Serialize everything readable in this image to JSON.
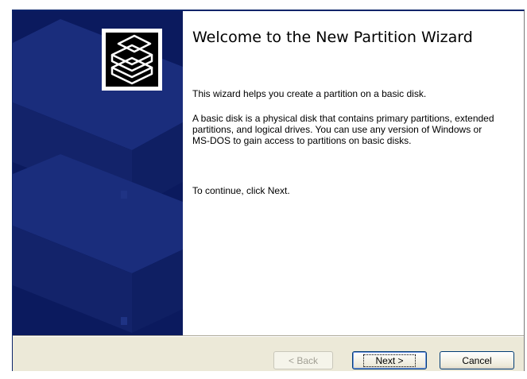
{
  "wizard": {
    "title": "Welcome to the New Partition Wizard",
    "paragraphs": [
      "This wizard helps you create a partition on a basic disk.",
      "A basic disk is a physical disk that contains primary partitions, extended partitions, and logical drives. You can use any version of Windows or MS-DOS to gain access to partitions on basic disks.",
      "To continue, click Next."
    ],
    "logo_icon": "stacked-disks-icon",
    "side_panel_color": "#0b1a5e"
  },
  "buttons": {
    "back_label": "< Back",
    "next_label": "Next >",
    "cancel_label": "Cancel"
  }
}
